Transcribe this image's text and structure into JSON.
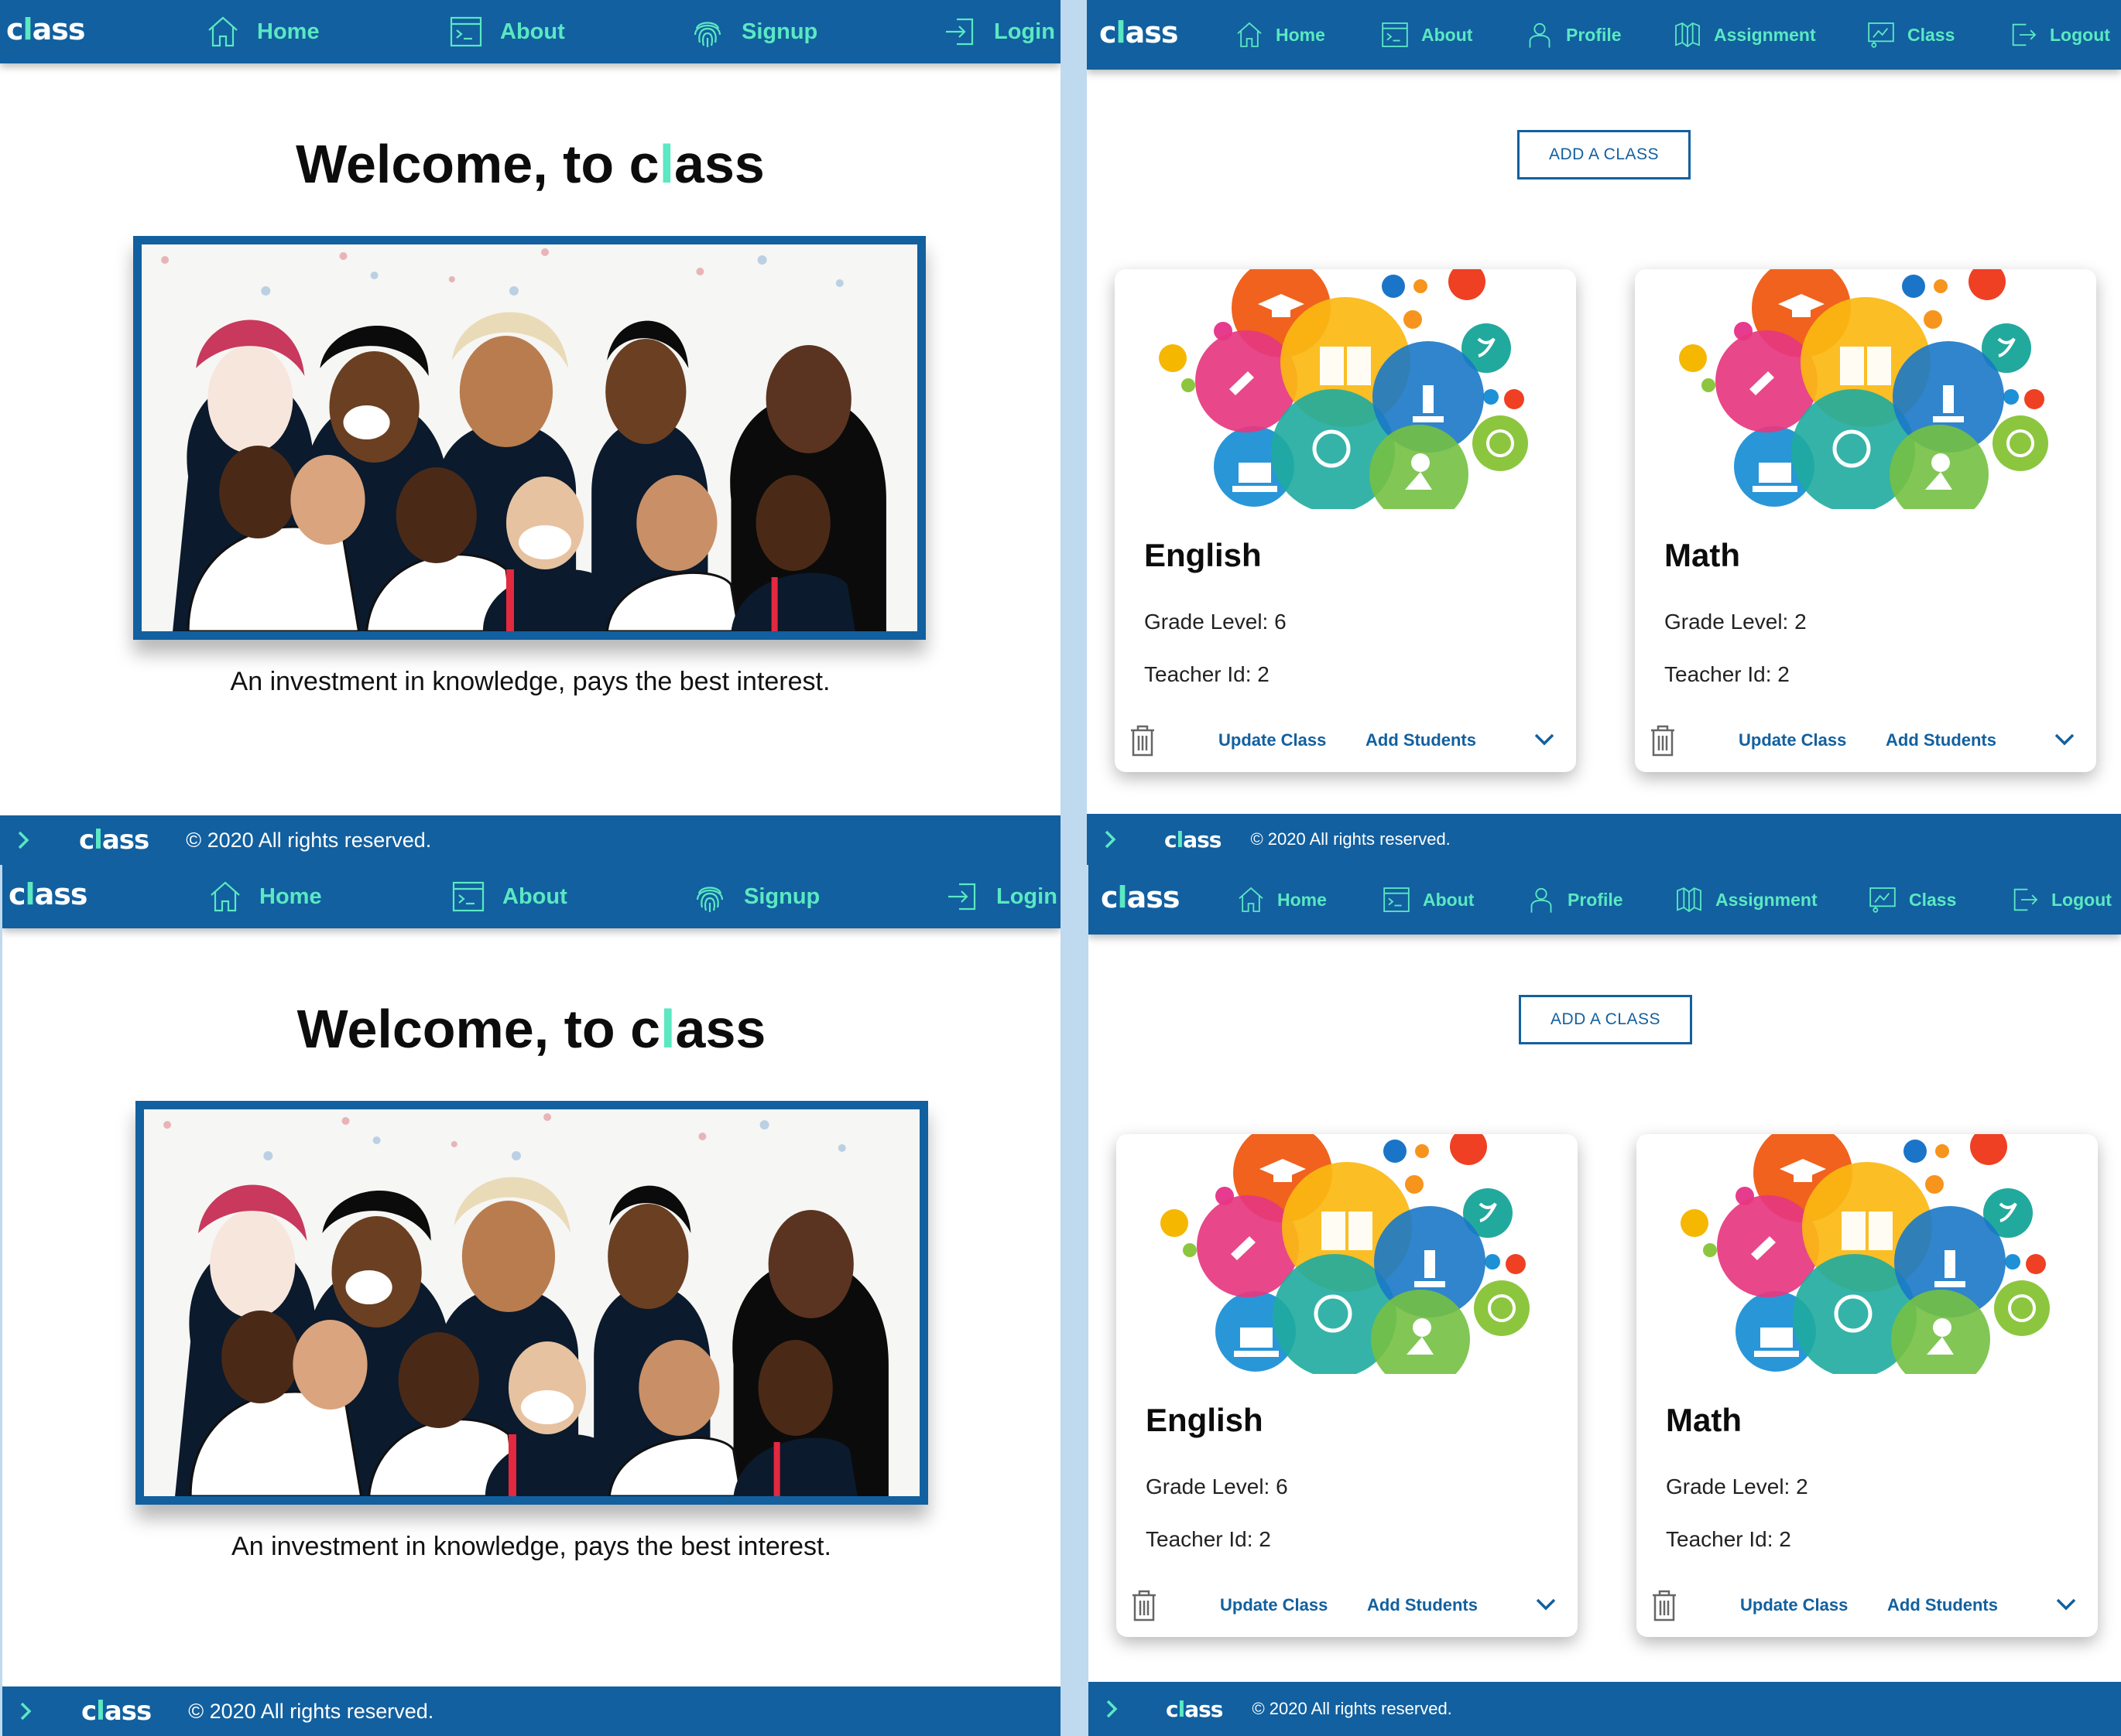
{
  "logo": {
    "c": "c",
    "l": "l",
    "rest": "ass"
  },
  "public_nav": {
    "home": "Home",
    "about": "About",
    "signup": "Signup",
    "login": "Login"
  },
  "auth_nav": {
    "home": "Home",
    "about": "About",
    "profile": "Profile",
    "assignment": "Assignment",
    "class": "Class",
    "logout": "Logout"
  },
  "landing": {
    "welcome_prefix": "Welcome, to c",
    "welcome_l": "l",
    "welcome_suffix": "ass",
    "quote": "An investment in knowledge, pays the best interest."
  },
  "dashboard": {
    "add_class_label": "ADD A CLASS",
    "classes": [
      {
        "title": "English",
        "grade": "Grade Level: 6",
        "teacher": "Teacher Id: 2",
        "update": "Update Class",
        "add_students": "Add Students"
      },
      {
        "title": "Math",
        "grade": "Grade Level: 2",
        "teacher": "Teacher Id: 2",
        "update": "Update Class",
        "add_students": "Add Students"
      }
    ]
  },
  "footer": {
    "copyright": "© 2020 All rights reserved."
  },
  "icons": {
    "home": "home-icon",
    "about": "terminal-icon",
    "signup": "fingerprint-icon",
    "login": "login-icon",
    "profile": "person-icon",
    "assignment": "book-icon",
    "class": "presentation-icon",
    "logout": "logout-icon",
    "trash": "trash-icon",
    "expand": "chevron-down-icon",
    "footer_toggle": "chevron-right-icon"
  },
  "colors": {
    "brand_blue": "#12609f",
    "accent_mint": "#5be8c2",
    "background": "#ffffff",
    "gap": "#bfd9ee"
  }
}
